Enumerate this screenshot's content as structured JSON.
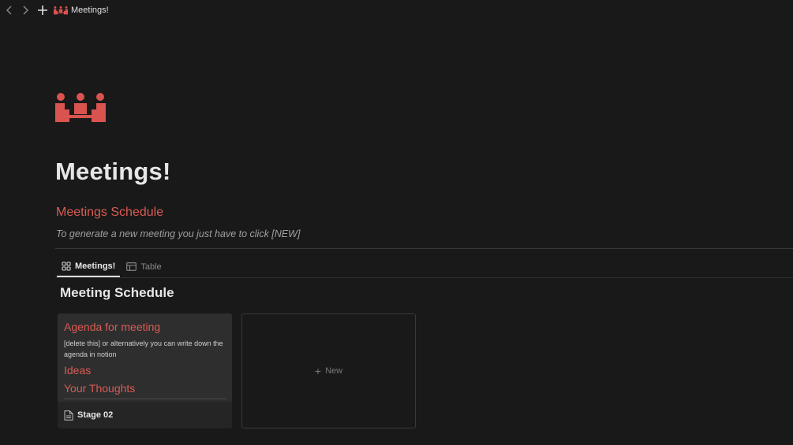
{
  "topbar": {
    "back_icon": "chevron-left-icon",
    "forward_icon": "chevron-right-icon",
    "add_icon": "plus-icon",
    "breadcrumb": "Meetings!"
  },
  "page": {
    "icon": "meeting-people-icon",
    "icon_color": "#d9534f",
    "title": "Meetings!",
    "section_heading": "Meetings Schedule",
    "hint": "To generate a new meeting you just have to click [NEW]"
  },
  "tabs": [
    {
      "label": "Meetings!",
      "icon": "gallery-icon",
      "active": true
    },
    {
      "label": "Table",
      "icon": "table-icon",
      "active": false
    }
  ],
  "board": {
    "title": "Meeting Schedule",
    "card": {
      "preview_heading": "Agenda for meeting",
      "preview_text": "[delete this] or alternatively you can write down the agenda in notion",
      "preview_heading2": "Ideas",
      "preview_heading3": "Your Thoughts",
      "name": "Stage 02",
      "icon": "page-icon"
    },
    "new_label": "New"
  },
  "colors": {
    "background": "#191919",
    "accent": "#d95b54"
  }
}
